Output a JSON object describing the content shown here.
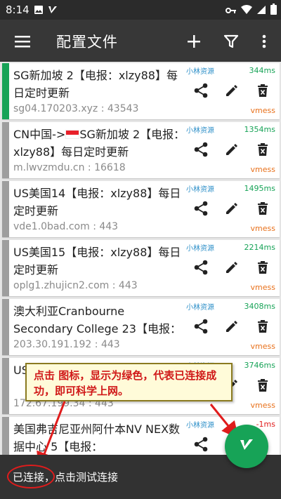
{
  "status_bar": {
    "time": "8:14",
    "icons": [
      "image-icon",
      "v-logo-icon",
      "key-icon",
      "wifi-icon",
      "signal-icon",
      "battery-icon"
    ]
  },
  "app_bar": {
    "title": "配置文件",
    "actions": [
      "menu-icon",
      "add-icon",
      "filter-icon",
      "more-icon"
    ]
  },
  "profiles": [
    {
      "name": "SG新加坡 2【电报：xlzy88】每日定时更新",
      "address": "sg04.170203.xyz : 43543",
      "subscription": "小林资源",
      "ping": "344ms",
      "type": "vmess",
      "active": true,
      "flag": false
    },
    {
      "name_prefix": "CN中国->",
      "name": "SG新加坡 2【电报：xlzy88】每日定时更新",
      "address": "m.lwvzmdu.cn : 16618",
      "subscription": "小林资源",
      "ping": "1354ms",
      "type": "vmess",
      "active": false,
      "flag": true
    },
    {
      "name": "US美国14【电报：xlzy88】每日定时更新",
      "address": "vde1.0bad.com : 443",
      "subscription": "小林资源",
      "ping": "1495ms",
      "type": "vmess",
      "active": false,
      "flag": false
    },
    {
      "name": "US美国15【电报：xlzy88】每日定时更新",
      "address": "oplg1.zhujicn2.com : 443",
      "subscription": "小林资源",
      "ping": "2214ms",
      "type": "vmess",
      "active": false,
      "flag": false
    },
    {
      "name": "澳大利亚Cranbourne Secondary College 23【电报：",
      "address": "203.30.191.192 : 443",
      "subscription": "小林资源",
      "ping": "3408ms",
      "type": "vmess",
      "active": false,
      "flag": false
    },
    {
      "name": "US",
      "address": "172.67.199.34 : 443",
      "subscription": "小林资源",
      "ping": "3746ms",
      "type": "vmess",
      "active": false,
      "flag": false
    },
    {
      "name": "美国弗吉尼亚州阿什本NV NEX数据中心 5【电报：",
      "address": "",
      "subscription": "小林资源",
      "ping": "-1ms",
      "type": "",
      "active": false,
      "flag": false
    }
  ],
  "callout": {
    "text": "点击 图标，显示为绿色，代表已连接成功，即可科学上网。"
  },
  "snackbar": {
    "message": "已连接，点击测试连接"
  },
  "colors": {
    "accent_green": "#17a357",
    "subscription_blue": "#2d8fc8",
    "type_orange": "#e8701a",
    "annotation_red": "#e01c1c",
    "toolbar": "#373737"
  }
}
